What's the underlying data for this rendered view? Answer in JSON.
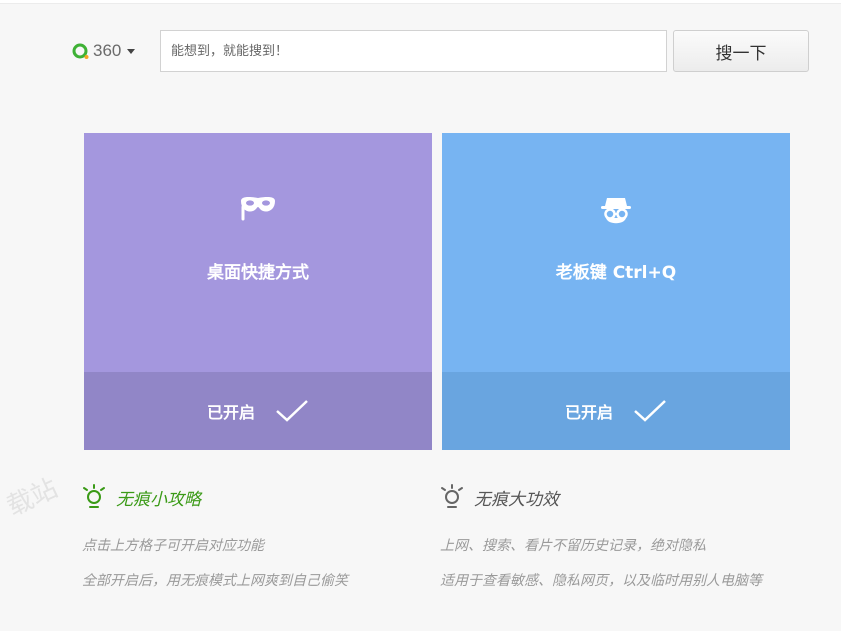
{
  "search": {
    "engine_label": "360",
    "placeholder": "能想到，就能搜到！",
    "button_label": "搜一下"
  },
  "cards": [
    {
      "title": "桌面快捷方式",
      "status": "已开启",
      "icon": "mask-icon",
      "color": "#a497de"
    },
    {
      "title": "老板键 Ctrl+Q",
      "status": "已开启",
      "icon": "incognito-icon",
      "color": "#77b4f2"
    }
  ],
  "tips": [
    {
      "title": "无痕小攻略",
      "icon": "lightbulb-icon",
      "color": "#3a9a16",
      "lines": [
        "点击上方格子可开启对应功能",
        "全部开启后，用无痕模式上网爽到自己偷笑"
      ]
    },
    {
      "title": "无痕大功效",
      "icon": "lightbulb-icon",
      "color": "#555555",
      "lines": [
        "上网、搜索、看片不留历史记录，绝对隐私",
        "适用于查看敏感、隐私网页，以及临时用别人电脑等"
      ]
    }
  ],
  "watermark": "载站"
}
